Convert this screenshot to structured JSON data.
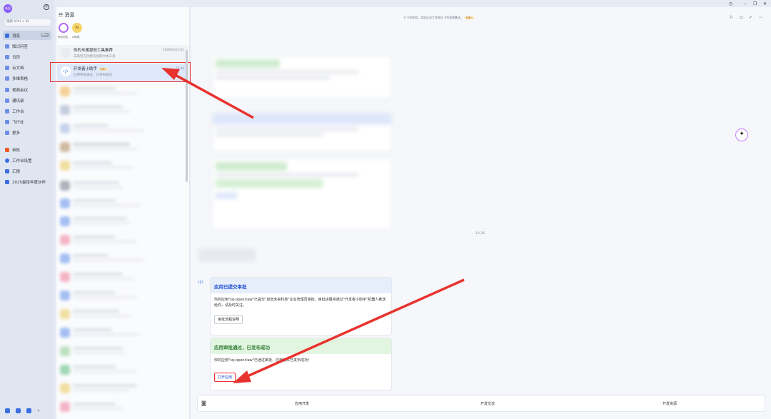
{
  "sidebar": {
    "avatar_text": "伟民",
    "search_placeholder": "搜索 (Ctrl + K)",
    "items": [
      {
        "label": "消息",
        "badge": "99+",
        "color": "#3b6fe0"
      },
      {
        "label": "知识问答",
        "color": "#3b6fe0"
      },
      {
        "label": "日历",
        "color": "#3b6fe0"
      },
      {
        "label": "云文档",
        "color": "#3b6fe0"
      },
      {
        "label": "多维表格",
        "color": "#3b6fe0"
      },
      {
        "label": "视频会议",
        "color": "#3b6fe0"
      },
      {
        "label": "通讯录",
        "color": "#3b6fe0"
      },
      {
        "label": "工作台",
        "color": "#3b6fe0"
      },
      {
        "label": "飞行社",
        "color": "#3b6fe0"
      },
      {
        "label": "更多",
        "color": "#3b6fe0"
      }
    ],
    "apps": [
      {
        "label": "审批",
        "color": "#f05a22"
      },
      {
        "label": "工作台设置",
        "color": "#3b6fe0"
      },
      {
        "label": "汇报",
        "color": "#3b6fe0"
      },
      {
        "label": "2025最佳年度伙伴",
        "color": "#3b6fe0"
      }
    ]
  },
  "list": {
    "header": "消息",
    "circle_a_label": "知识问答",
    "circle_b_label": "AI助理",
    "circle_b_icon": "AI",
    "rows": [
      {
        "title": "你的专属提效工具推荐",
        "subtitle": "未来智方创意信创新文本工具",
        "time": "2026年4月13日"
      },
      {
        "title": "开发者小助手",
        "tag": "机器人",
        "subtitle": "应用审批通过，已发布成功",
        "time": "14:40"
      }
    ]
  },
  "chat": {
    "top_notice": "于飞书应用，实现企业工作流与飞书消息触达。",
    "top_notice_tag": "机器人",
    "time_divider": "10:36",
    "card1": {
      "title": "应用已提交审批",
      "body": "你的应用\"sq-openclaw\"已提交\"启智未来科技\"企业管理员审批。审批进展将通过\"开发者小助手\"机器人推送给你，请及时关注。",
      "button": "审批流程说明"
    },
    "card2": {
      "title": "应用审批通过，已发布成功",
      "body": "你的应用\"sq-openclaw\"已通过审批，应用版本已发布成功！",
      "button": "打开应用"
    },
    "bottom_bar": [
      "应用开发",
      "开发交流",
      "开发资源"
    ],
    "floating_icon": "robot-icon"
  },
  "colors": {
    "arrow": "#e8322e",
    "highlight": "#e8322e"
  }
}
